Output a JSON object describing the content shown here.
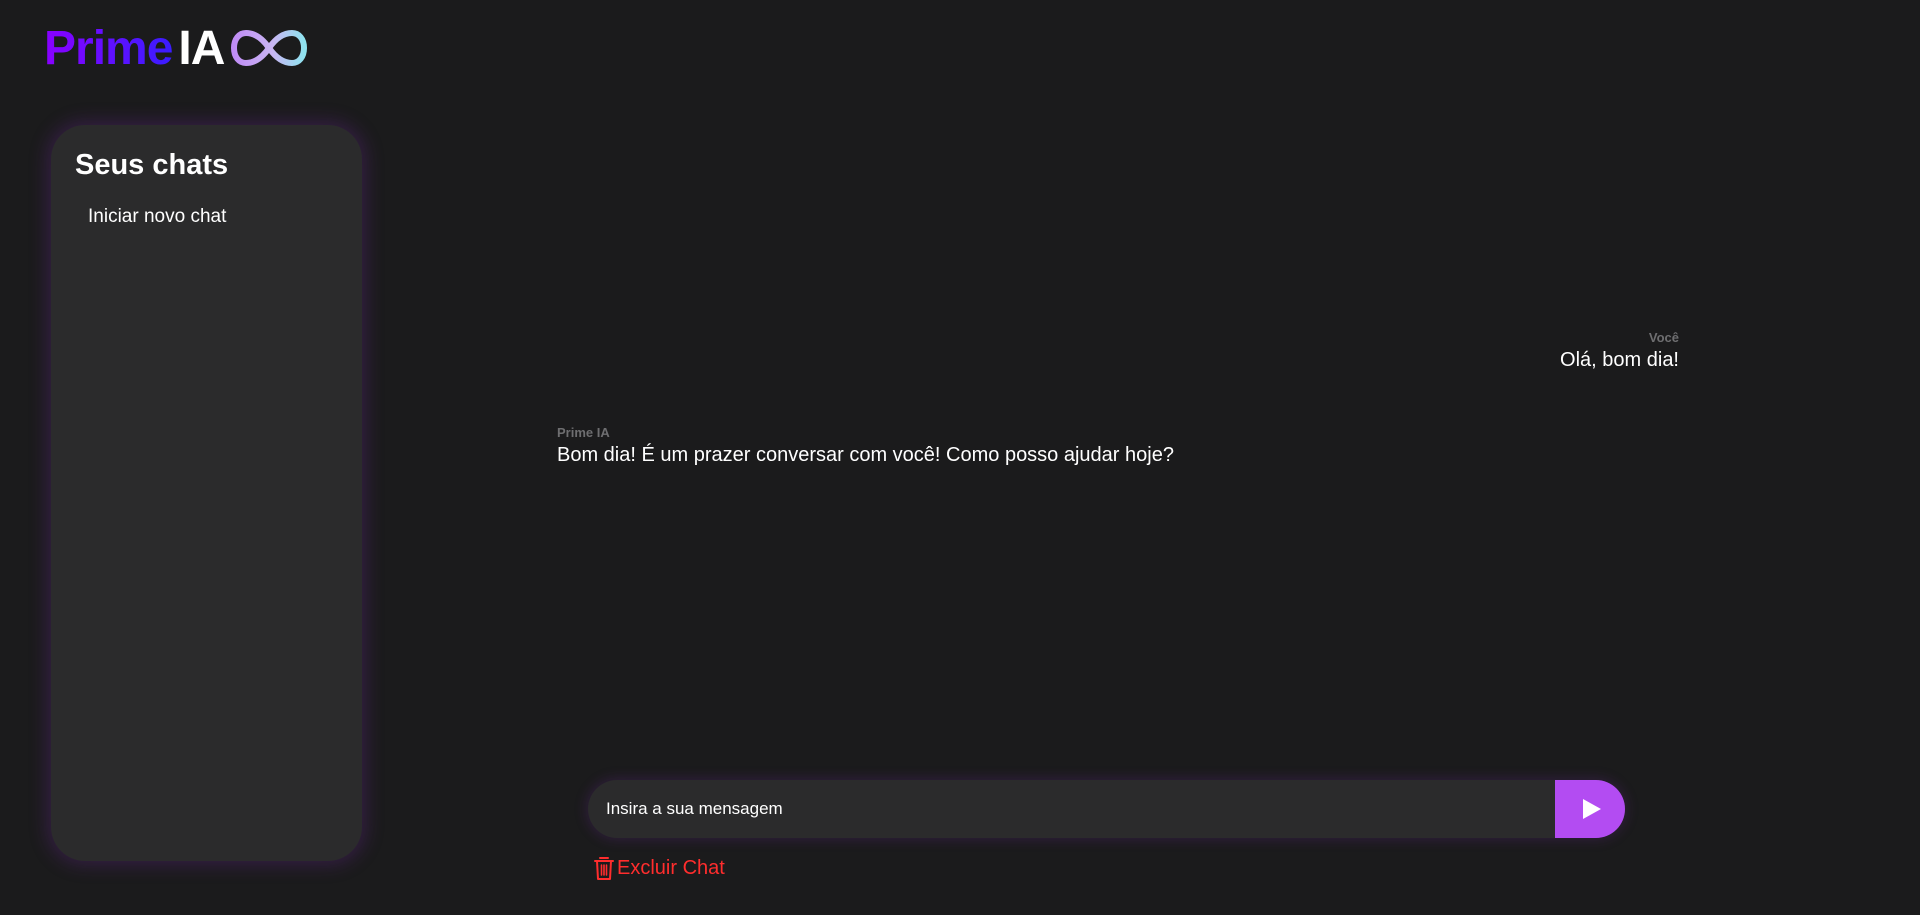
{
  "logo": {
    "prime": "Prime",
    "ia": "IA",
    "icon": "infinity-icon"
  },
  "sidebar": {
    "title": "Seus chats",
    "new_chat": "Iniciar novo chat"
  },
  "messages": [
    {
      "sender": "Você",
      "text": "Olá, bom dia!",
      "role": "user"
    },
    {
      "sender": "Prime IA",
      "text": "Bom dia! É um prazer conversar com você! Como posso ajudar hoje?",
      "role": "assistant"
    }
  ],
  "composer": {
    "placeholder": "Insira a sua mensagem",
    "value": "",
    "send_icon": "play-icon"
  },
  "actions": {
    "delete_label": "Excluir Chat",
    "delete_icon": "trash-icon"
  },
  "colors": {
    "background": "#1b1b1c",
    "panel": "#2b2b2c",
    "accent": "#b34cf2",
    "danger": "#ff2d2d",
    "muted": "#6e6e70"
  }
}
